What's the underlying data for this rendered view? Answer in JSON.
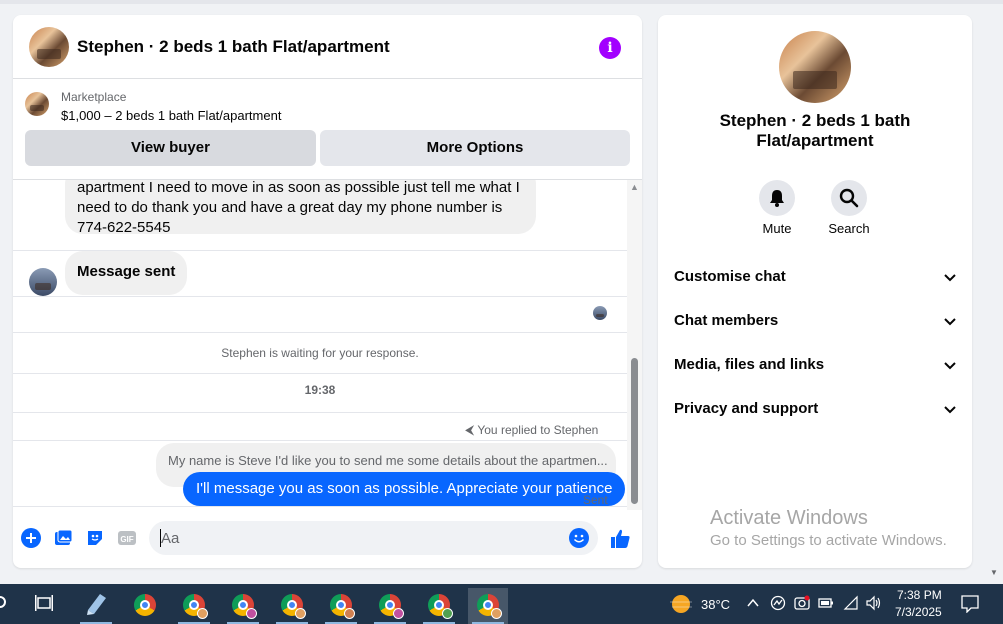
{
  "chat": {
    "title": "Stephen · 2 beds 1 bath Flat/apartment",
    "marketplace_label": "Marketplace",
    "listing": "$1,000 – 2 beds 1 bath Flat/apartment",
    "view_buyer": "View buyer",
    "more_options": "More Options",
    "messages": {
      "incoming_line1": "apartment I need to move in as soon as possible just tell me what I",
      "incoming_line2": "need to do thank you and have a great day my phone number is",
      "incoming_line3": "774-622-5545",
      "message_sent": "Message sent",
      "waiting": "Stephen is waiting for your response.",
      "time": "19:38",
      "replied_to": "You replied to Stephen",
      "quoted": "My name is Steve I'd like you to send me some details about the apartmen...",
      "outgoing": "I'll message you as soon as possible. Appreciate your patience",
      "status": "Sent"
    },
    "composer_placeholder": "Aa"
  },
  "info_panel": {
    "name": "Stephen · 2 beds 1 bath Flat/apartment",
    "mute_label": "Mute",
    "search_label": "Search",
    "menu": [
      {
        "label": "Customise chat"
      },
      {
        "label": "Chat members"
      },
      {
        "label": "Media, files and links"
      },
      {
        "label": "Privacy and support"
      }
    ]
  },
  "watermark": {
    "title": "Activate Windows",
    "subtitle": "Go to Settings to activate Windows."
  },
  "taskbar": {
    "temperature": "38°C",
    "time": "7:38 PM",
    "date": "7/3/2025"
  },
  "colors": {
    "accent": "#0866ff",
    "info_icon": "#a200ff",
    "taskbar": "#1f3349"
  }
}
